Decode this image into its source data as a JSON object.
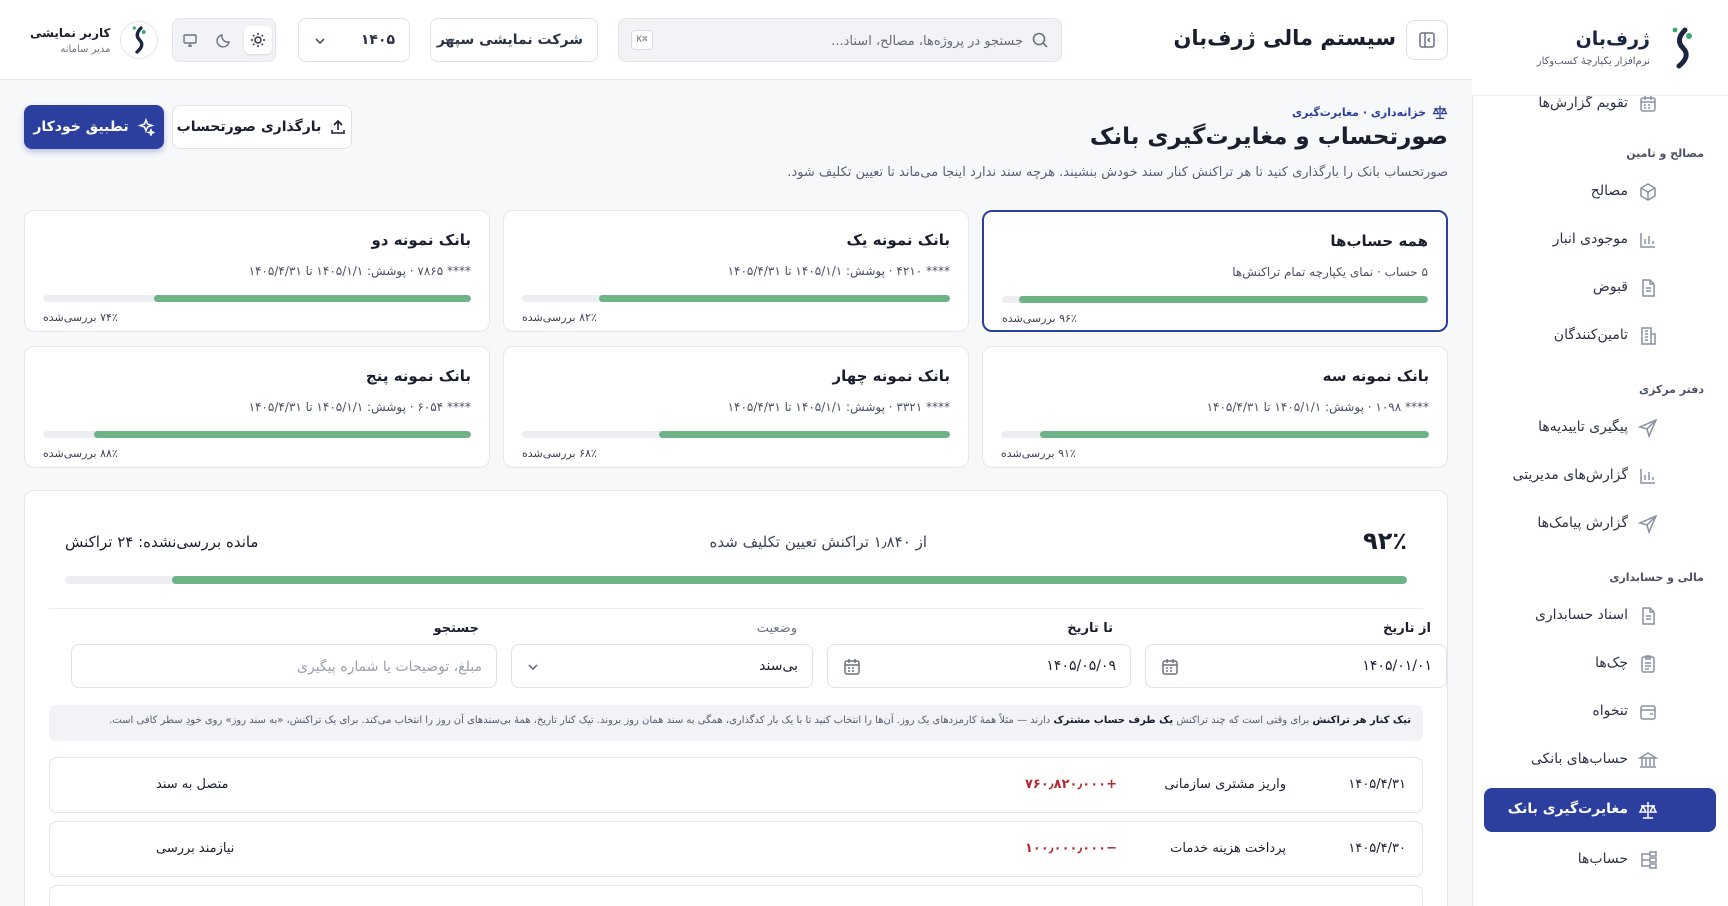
{
  "sidebar": {
    "brand_title": "ژرف‌بان",
    "brand_subtitle": "نرم‌افزار یکپارچهٔ کسب‌وکار",
    "items_top": [
      {
        "label": "تقویم گزارش‌ها",
        "icon": "calendar-icon"
      }
    ],
    "sections": [
      {
        "title": "مصالح و تامین",
        "items": [
          {
            "label": "مصالح",
            "icon": "box-icon"
          },
          {
            "label": "موجودی انبار",
            "icon": "bar-chart-icon"
          },
          {
            "label": "قبوض",
            "icon": "document-icon"
          },
          {
            "label": "تامین‌کنندگان",
            "icon": "building-icon"
          }
        ]
      },
      {
        "title": "دفتر مرکزی",
        "items": [
          {
            "label": "پیگیری تاییدیه‌ها",
            "icon": "send-icon"
          },
          {
            "label": "گزارش‌های مدیریتی",
            "icon": "bar-chart-icon"
          },
          {
            "label": "گزارش پیامک‌ها",
            "icon": "send-icon"
          }
        ]
      },
      {
        "title": "مالی و حسابداری",
        "items": [
          {
            "label": "اسناد حسابداری",
            "icon": "document-icon"
          },
          {
            "label": "چک‌ها",
            "icon": "clipboard-icon"
          },
          {
            "label": "تنخواه",
            "icon": "wallet-icon"
          },
          {
            "label": "حساب‌های بانکی",
            "icon": "bank-icon"
          },
          {
            "label": "مغایرت‌گیری بانک",
            "icon": "scale-icon",
            "active": true
          },
          {
            "label": "حساب‌ها",
            "icon": "tree-icon"
          }
        ]
      }
    ]
  },
  "header": {
    "title": "سیستم مالی ژرف‌بان",
    "search_placeholder": "جستجو در پروژه‌ها، مصالح، اسناد...",
    "search_shortcut": "K⌘",
    "company": "شرکت نمایشی سپهر",
    "year": "۱۴۰۵",
    "user_name": "کاربر نمایشی",
    "user_role": "مدیر سامانه"
  },
  "page": {
    "breadcrumb": "خزانه‌داری · مغایرت‌گیری",
    "title": "صورتحساب و مغایرت‌گیری بانک",
    "description": "صورتحساب بانک را بارگذاری کنید تا هر تراکنش کنار سند خودش بنشیند. هرچه سند ندارد اینجا می‌ماند تا تعیین تکلیف شود.",
    "auto_match_label": "تطبیق خودکار",
    "upload_label": "بارگذاری صورتحساب"
  },
  "accounts": [
    {
      "name": "همه حساب‌ها",
      "meta": "۵ حساب · نمای یکپارچه تمام تراکنش‌ها",
      "progress": 0.96,
      "pct_label": "۹۶٪ بررسی‌شده",
      "selected": true
    },
    {
      "name": "بانک نمونه یک",
      "meta": "**** ۴۲۱۰ · پوشش: ۱۴۰۵/۱/۱ تا ۱۴۰۵/۴/۳۱",
      "progress": 0.82,
      "pct_label": "۸۲٪ بررسی‌شده"
    },
    {
      "name": "بانک نمونه دو",
      "meta": "**** ۷۸۶۵ · پوشش: ۱۴۰۵/۱/۱ تا ۱۴۰۵/۴/۳۱",
      "progress": 0.74,
      "pct_label": "۷۴٪ بررسی‌شده"
    },
    {
      "name": "بانک نمونه سه",
      "meta": "**** ۱۰۹۸ · پوشش: ۱۴۰۵/۱/۱ تا ۱۴۰۵/۴/۳۱",
      "progress": 0.91,
      "pct_label": "۹۱٪ بررسی‌شده"
    },
    {
      "name": "بانک نمونه چهار",
      "meta": "**** ۳۳۲۱ · پوشش: ۱۴۰۵/۱/۱ تا ۱۴۰۵/۴/۳۱",
      "progress": 0.68,
      "pct_label": "۶۸٪ بررسی‌شده"
    },
    {
      "name": "بانک نمونه پنج",
      "meta": "**** ۶۰۵۴ · پوشش: ۱۴۰۵/۱/۱ تا ۱۴۰۵/۴/۳۱",
      "progress": 0.88,
      "pct_label": "۸۸٪ بررسی‌شده"
    }
  ],
  "summary": {
    "percent": "۹۲٪",
    "progress": 0.92,
    "text": "از ۱٫۸۴۰ تراکنش تعیین تکلیف شده",
    "remaining": "مانده بررسی‌نشده: ۲۴ تراکنش"
  },
  "filters": {
    "from_label": "از تاریخ",
    "from_value": "۱۴۰۵/۰۱/۰۱",
    "to_label": "تا تاریخ",
    "to_value": "۱۴۰۵/۰۵/۰۹",
    "status_label": "وضعیت",
    "status_value": "بی‌سند",
    "search_label": "جستجو",
    "search_placeholder": "مبلغ، توضیحات یا شماره پیگیری"
  },
  "notice": {
    "bold1": "تیک کنار هر تراکنش",
    "part1": " برای وقتی است که چند تراکنش ",
    "bold2": "یک طرف حساب مشترک",
    "part2": " دارند — مثلاً همهٔ کارمزدهای یک روز. آن‌ها را انتخاب کنید تا با یک بار کدگذاری، همگی به سند همان روز بروند. تیک کنار تاریخ، همهٔ بی‌سندهای آن روز را انتخاب می‌کند. برای یک تراکنش، «به سند روز» روی خودِ سطر کافی است."
  },
  "transactions": [
    {
      "date": "۱۴۰۵/۴/۳۱",
      "description": "واریز مشتری سازمانی",
      "amount": "+۷۶۰٫۸۲۰٫۰۰۰",
      "status": "متصل به سند"
    },
    {
      "date": "۱۴۰۵/۴/۳۰",
      "description": "پرداخت هزینه خدمات",
      "amount": "−۱۰۰٫۰۰۰٫۰۰۰",
      "status": "نیازمند بررسی"
    }
  ],
  "colors": {
    "accent": "#2c3f9e",
    "progress": "#6db385",
    "negative": "#b3292f"
  }
}
